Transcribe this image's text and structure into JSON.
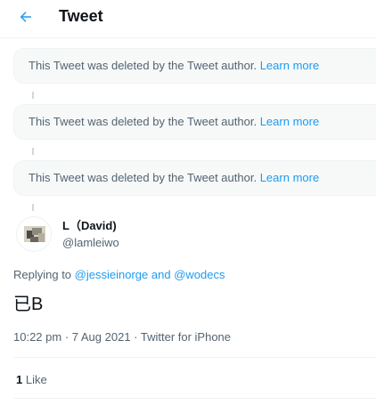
{
  "header": {
    "title": "Tweet",
    "back_icon": "arrow-left-icon",
    "accent": "#1d9bf0"
  },
  "deleted_tweets": [
    {
      "text": "This Tweet was deleted by the Tweet author.",
      "link": "Learn more"
    },
    {
      "text": "This Tweet was deleted by the Tweet author.",
      "link": "Learn more"
    },
    {
      "text": "This Tweet was deleted by the Tweet author.",
      "link": "Learn more"
    }
  ],
  "tweet": {
    "author_name": "L（David)",
    "handle": "@lamleiwo",
    "replying_prefix": "Replying to",
    "replying_user1": "@jessieinorge",
    "replying_and": "and",
    "replying_user2": "@wodecs",
    "text": "已B",
    "time": "10:22 pm · 7 Aug 2021 · Twitter for iPhone",
    "like_count": "1",
    "like_label": "Like"
  }
}
